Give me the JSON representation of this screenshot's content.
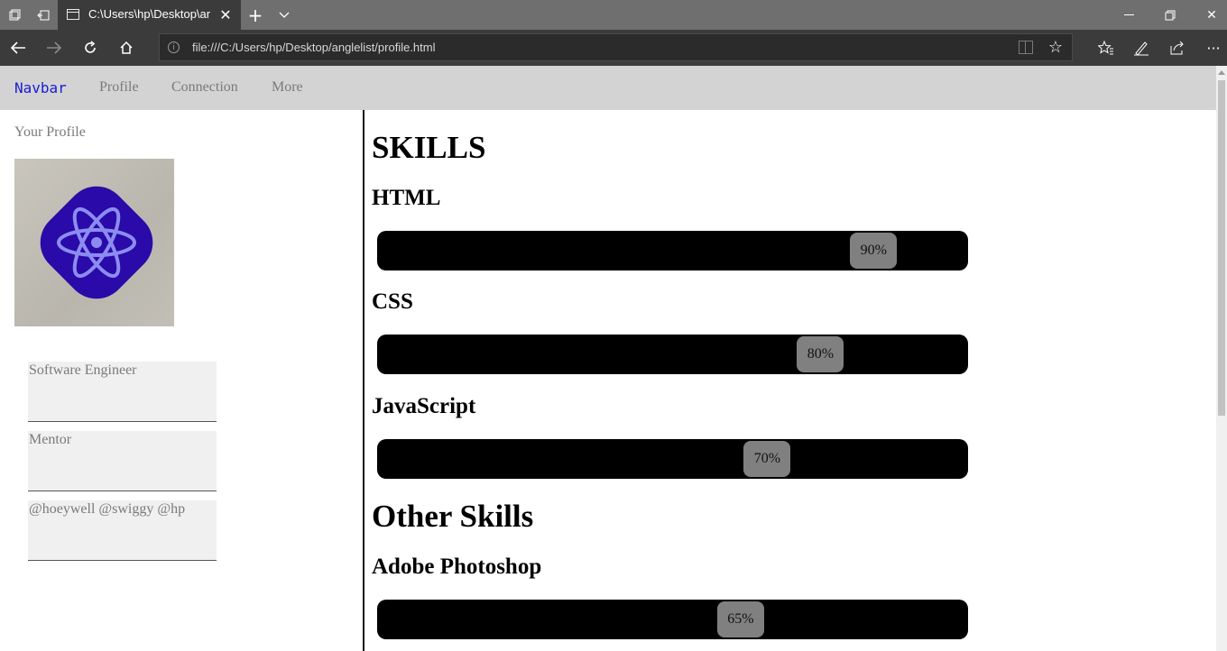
{
  "browser": {
    "tab_title": "C:\\Users\\hp\\Desktop\\ar",
    "url": "file:///C:/Users/hp/Desktop/anglelist/profile.html"
  },
  "navbar": {
    "brand": "Navbar",
    "links": [
      "Profile",
      "Connection",
      "More"
    ]
  },
  "sidebar": {
    "heading": "Your Profile",
    "cards": [
      "Software Engineer",
      "Mentor",
      "@hoeywell @swiggy @hp"
    ]
  },
  "skills": {
    "heading": "SKILLS",
    "items": [
      {
        "name": "HTML",
        "label": "90%",
        "level": 0.9
      },
      {
        "name": "CSS",
        "label": "80%",
        "level": 0.8
      },
      {
        "name": "JavaScript",
        "label": "70%",
        "level": 0.7
      }
    ]
  },
  "other_skills": {
    "heading": "Other Skills",
    "items": [
      {
        "name": "Adobe Photoshop",
        "label": "65%",
        "level": 0.65
      }
    ]
  },
  "colors": {
    "nav_background": "#d3d3d3",
    "brand": "#1a1ad6",
    "bar": "#000000",
    "bar_knob": "#808080",
    "card_background": "#f0f0f0"
  },
  "icons": {
    "avatar": "react-atom-logo"
  }
}
